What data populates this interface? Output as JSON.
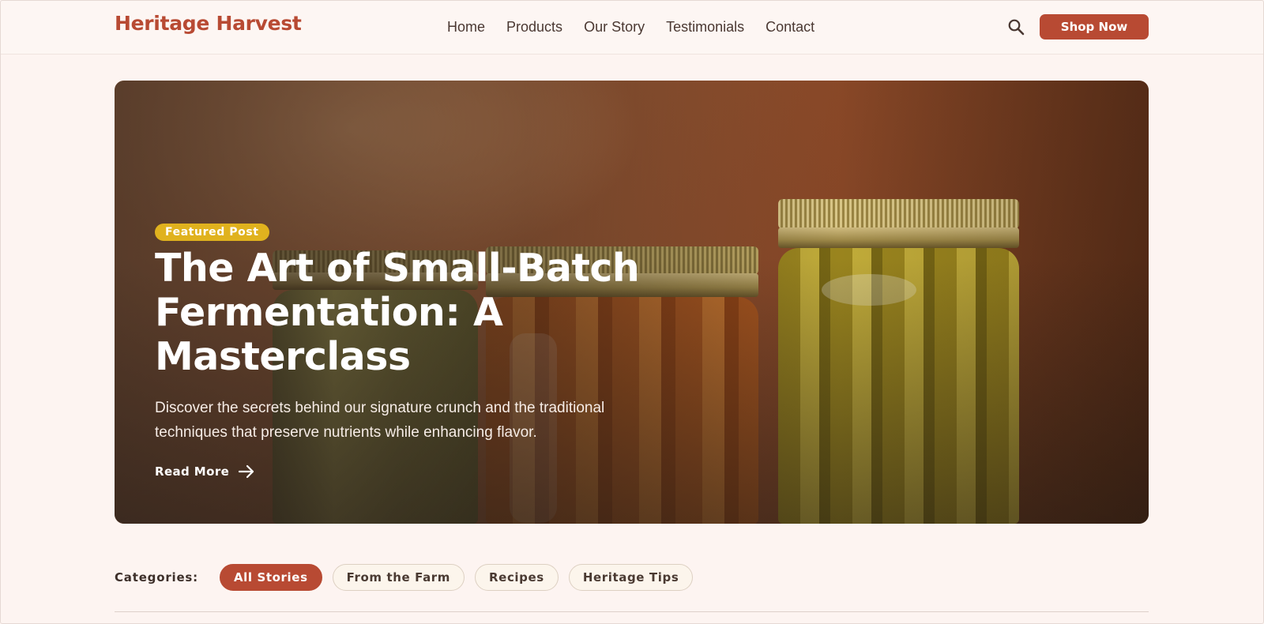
{
  "brand": {
    "name": "Heritage Harvest",
    "accent": "#b84a33"
  },
  "nav": {
    "items": [
      "Home",
      "Products",
      "Our Story",
      "Testimonials",
      "Contact"
    ]
  },
  "header": {
    "search_icon": "search-icon",
    "shop_label": "Shop Now"
  },
  "hero": {
    "badge": "Featured Post",
    "badge_color": "#e0b21e",
    "title": "The Art of Small-Batch Fermentation: A Masterclass",
    "description": "Discover the secrets behind our signature crunch and the traditional techniques that preserve nutrients while enhancing flavor.",
    "cta": "Read More",
    "cta_icon": "arrow-right-icon"
  },
  "categories": {
    "label": "Categories:",
    "chips": [
      "All Stories",
      "From the Farm",
      "Recipes",
      "Heritage Tips"
    ],
    "active": "All Stories"
  }
}
